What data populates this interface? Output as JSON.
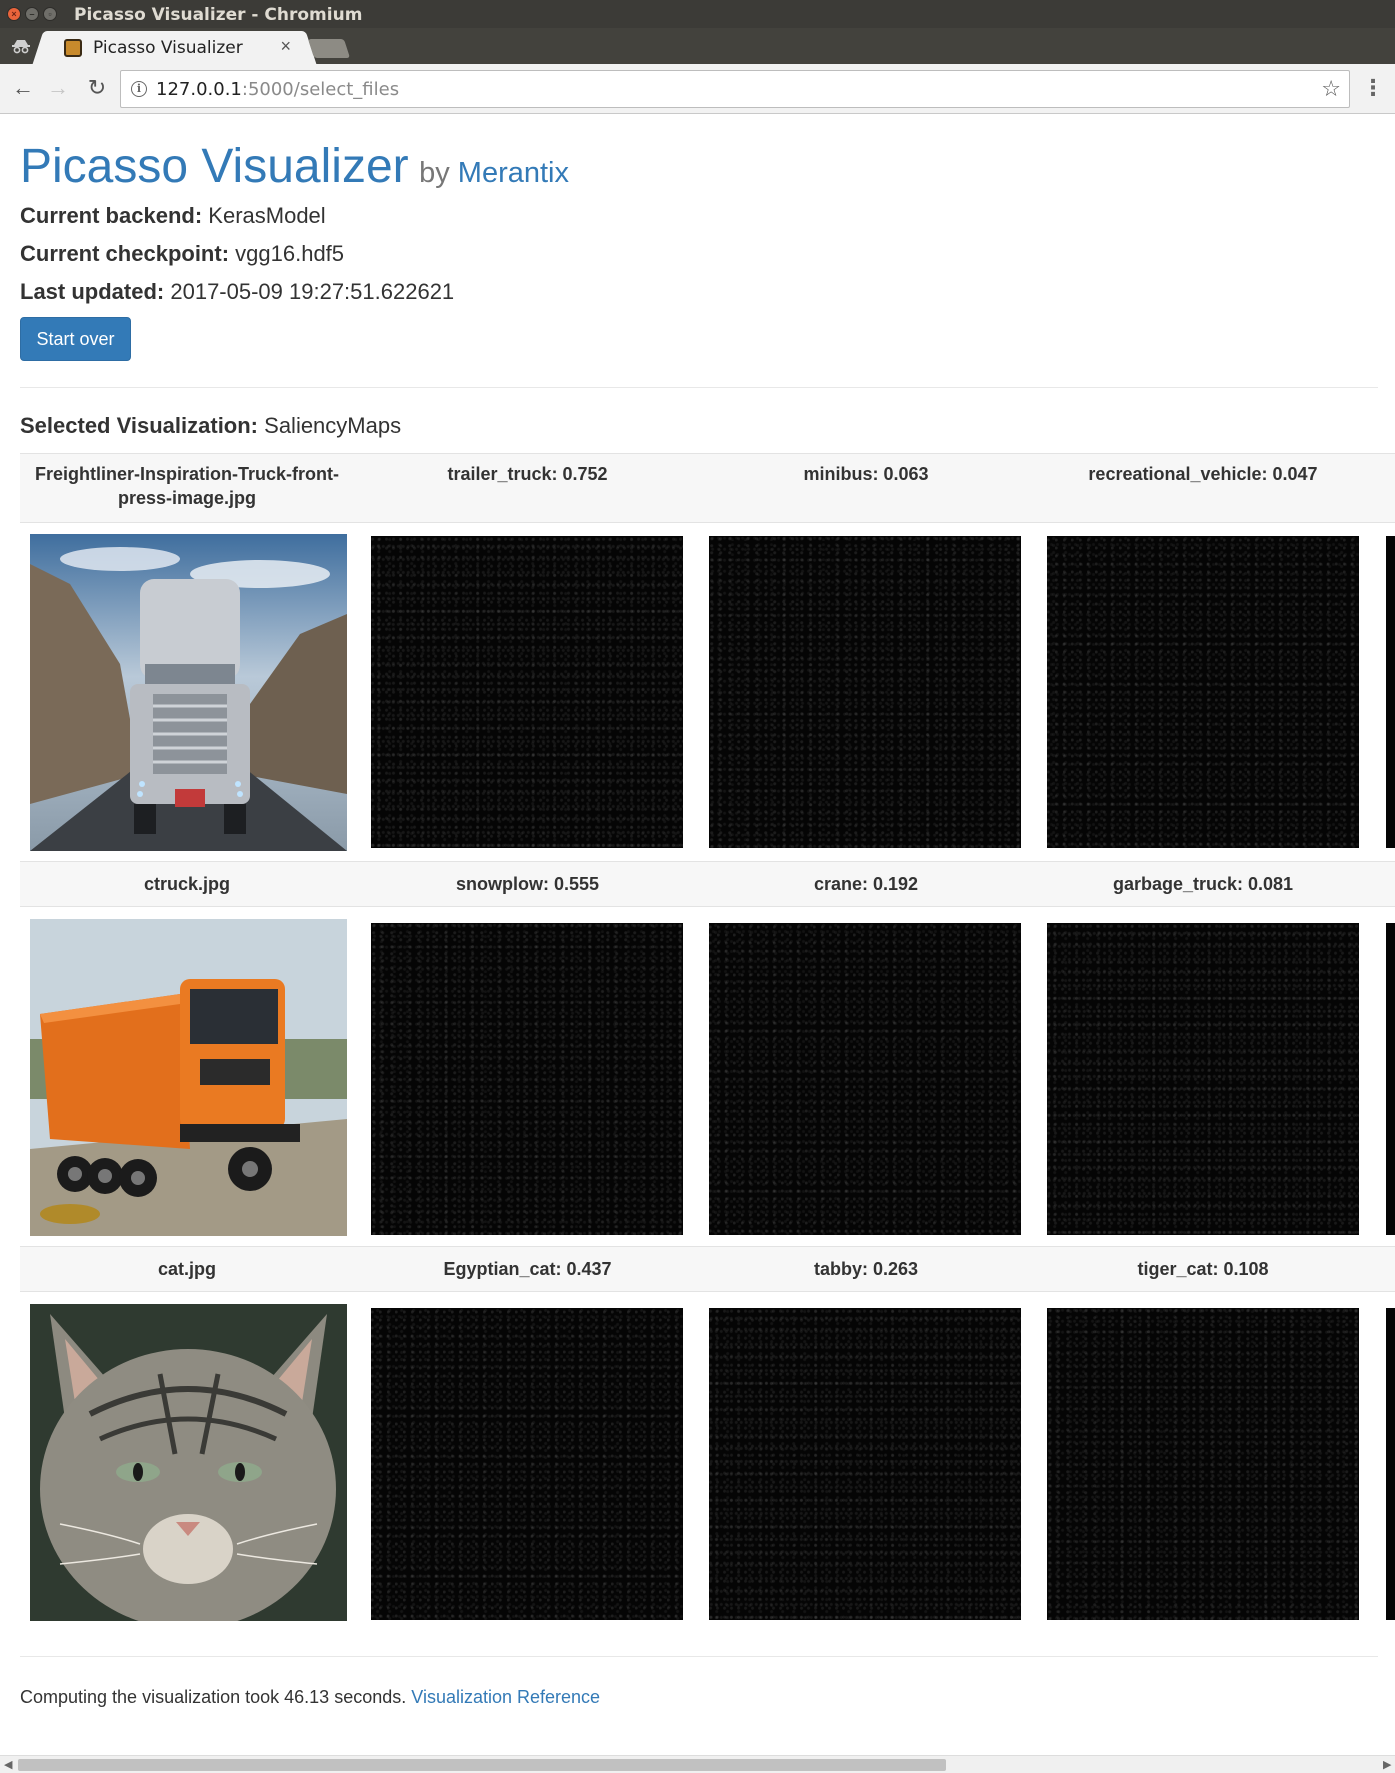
{
  "window": {
    "title": "Picasso Visualizer - Chromium"
  },
  "tab": {
    "title": "Picasso Visualizer",
    "close": "×"
  },
  "address": {
    "host": "127.0.0.1",
    "path": ":5000/select_files"
  },
  "header": {
    "brand": "Picasso Visualizer",
    "by": "by",
    "company": "Merantix"
  },
  "meta": {
    "backend_label": "Current backend:",
    "backend_value": "KerasModel",
    "checkpoint_label": "Current checkpoint:",
    "checkpoint_value": "vgg16.hdf5",
    "updated_label": "Last updated:",
    "updated_value": "2017-05-09 19:27:51.622621"
  },
  "start_over": "Start over",
  "selection": {
    "label": "Selected Visualization:",
    "value": "SaliencyMaps"
  },
  "rows": [
    {
      "filename": "Freightliner-Inspiration-Truck-front-press-image.jpg",
      "predictions": [
        "trailer_truck: 0.752",
        "minibus: 0.063",
        "recreational_vehicle: 0.047"
      ]
    },
    {
      "filename": "ctruck.jpg",
      "predictions": [
        "snowplow: 0.555",
        "crane: 0.192",
        "garbage_truck: 0.081"
      ]
    },
    {
      "filename": "cat.jpg",
      "predictions": [
        "Egyptian_cat: 0.437",
        "tabby: 0.263",
        "tiger_cat: 0.108"
      ]
    }
  ],
  "footer": {
    "text": "Computing the visualization took 46.13 seconds.",
    "link": "Visualization Reference"
  },
  "colors": {
    "link": "#337ab7",
    "button": "#337ab7"
  }
}
